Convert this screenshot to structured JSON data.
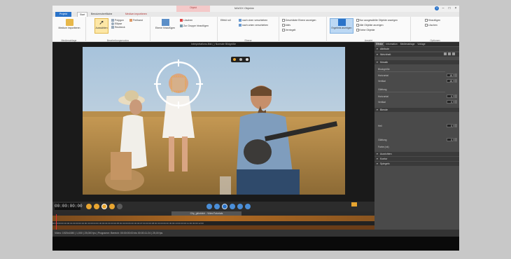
{
  "titlebar": {
    "title": "MAGIX Objekte",
    "context_group": "Objekt"
  },
  "tabs": [
    "Projekt",
    "Start",
    "Benutzeroberfläche",
    "Medium importieren"
  ],
  "ribbon": {
    "import_label": "Medium importieren",
    "group_import": "Medienablage",
    "select_label": "Auswählen",
    "shapes": [
      "Polygon",
      "Ellipse",
      "Rechteck",
      "Freihand",
      "Text"
    ],
    "group_draw": "Bearbeitungsmodus",
    "layer_add": "Ebene hinzufügen",
    "delete_label": "Löschen",
    "group_add": "Zur Gruppe hinzufügen",
    "effekt_label": "Effekt roll",
    "move_up": "nach oben verschieben",
    "move_down": "nach unten verschieben",
    "group_ebene": "Ebene",
    "checks_a": [
      "Geschützte Ebene anzeigen",
      "Aktiv",
      "Verriegelt"
    ],
    "overlay_btn": "Ergebnis anzeigen",
    "checks_b": [
      "Nur ausgewählte Objekte anzeigen",
      "Alle Objekte anzeigen",
      "Keine Objekte"
    ],
    "group_ansicht": "Ansicht",
    "checks_c": [
      "Hinzufügen",
      "Löschen"
    ],
    "group_optionen": "Optionen"
  },
  "preview": {
    "title": "Interpretations-Bild  ( ) Normale Bildgröße",
    "timecode": "00:00:00:00"
  },
  "timeline": {
    "clip_label": "Clip_glücklich - VideoTutorials",
    "ruler": "00:00:00:00   00:00:01:00   00:00:02:00   00:00:03:00   00:00:04:00   00:00:05:00   00:00:06:00   00:00:07:00   00:00:08:00   00:00:09:00   00:00:10:00   00:00:11:00   00:00:12:00"
  },
  "status": "Video: 1920x1080 | 1,000 | 25,000 fps | Programm: Bereich: 00:00:00:00 bis 00:00:11:24 | 25,00 fps",
  "rpanel": {
    "tabs": [
      "Effekte",
      "Information",
      "Medienablage",
      "Vorlage"
    ],
    "sections": {
      "attributes": "Attribute",
      "softness": "Weichheit",
      "mosaic": "Mosaik",
      "blend": "Blende",
      "expert": "Ausrichten",
      "contour": "Kontur",
      "rotate": "Spiegeln"
    },
    "mosaic_labels": [
      "Blockgröße",
      "Horizontal",
      "Vertikal",
      "Glättung",
      "Horizontal",
      "Vertikal"
    ],
    "mosaic_values": [
      "15",
      "15",
      "0",
      "0"
    ],
    "blend_labels": [
      "Hell",
      "Glättung",
      "Farbe (rot)"
    ],
    "blend_values": [
      "0",
      "0"
    ]
  },
  "colors": {
    "accent": "#2a73c9",
    "timeline": "#b06a22",
    "transport": "#e8a530"
  }
}
